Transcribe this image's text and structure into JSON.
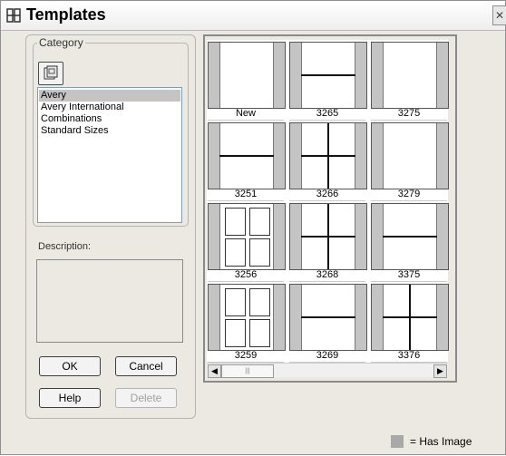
{
  "window": {
    "title": "Templates",
    "close_icon": "close-icon"
  },
  "category": {
    "legend": "Category",
    "items": [
      "Avery",
      "Avery International",
      "Combinations",
      "Standard Sizes"
    ],
    "selected": "Avery"
  },
  "description": {
    "label": "Description:",
    "value": ""
  },
  "buttons": {
    "ok": "OK",
    "cancel": "Cancel",
    "help": "Help",
    "delete": "Delete"
  },
  "templates": [
    "New",
    "3265",
    "3275",
    "3251",
    "3266",
    "3279",
    "3256",
    "3268",
    "3375",
    "3259",
    "3269",
    "3376"
  ],
  "scrollbar": {
    "left_icon": "arrow-left-icon",
    "right_icon": "arrow-right-icon",
    "thumb_grip": "grip-icon"
  },
  "legend": {
    "text": "= Has Image",
    "swatch_color": "#a9a9a9"
  }
}
